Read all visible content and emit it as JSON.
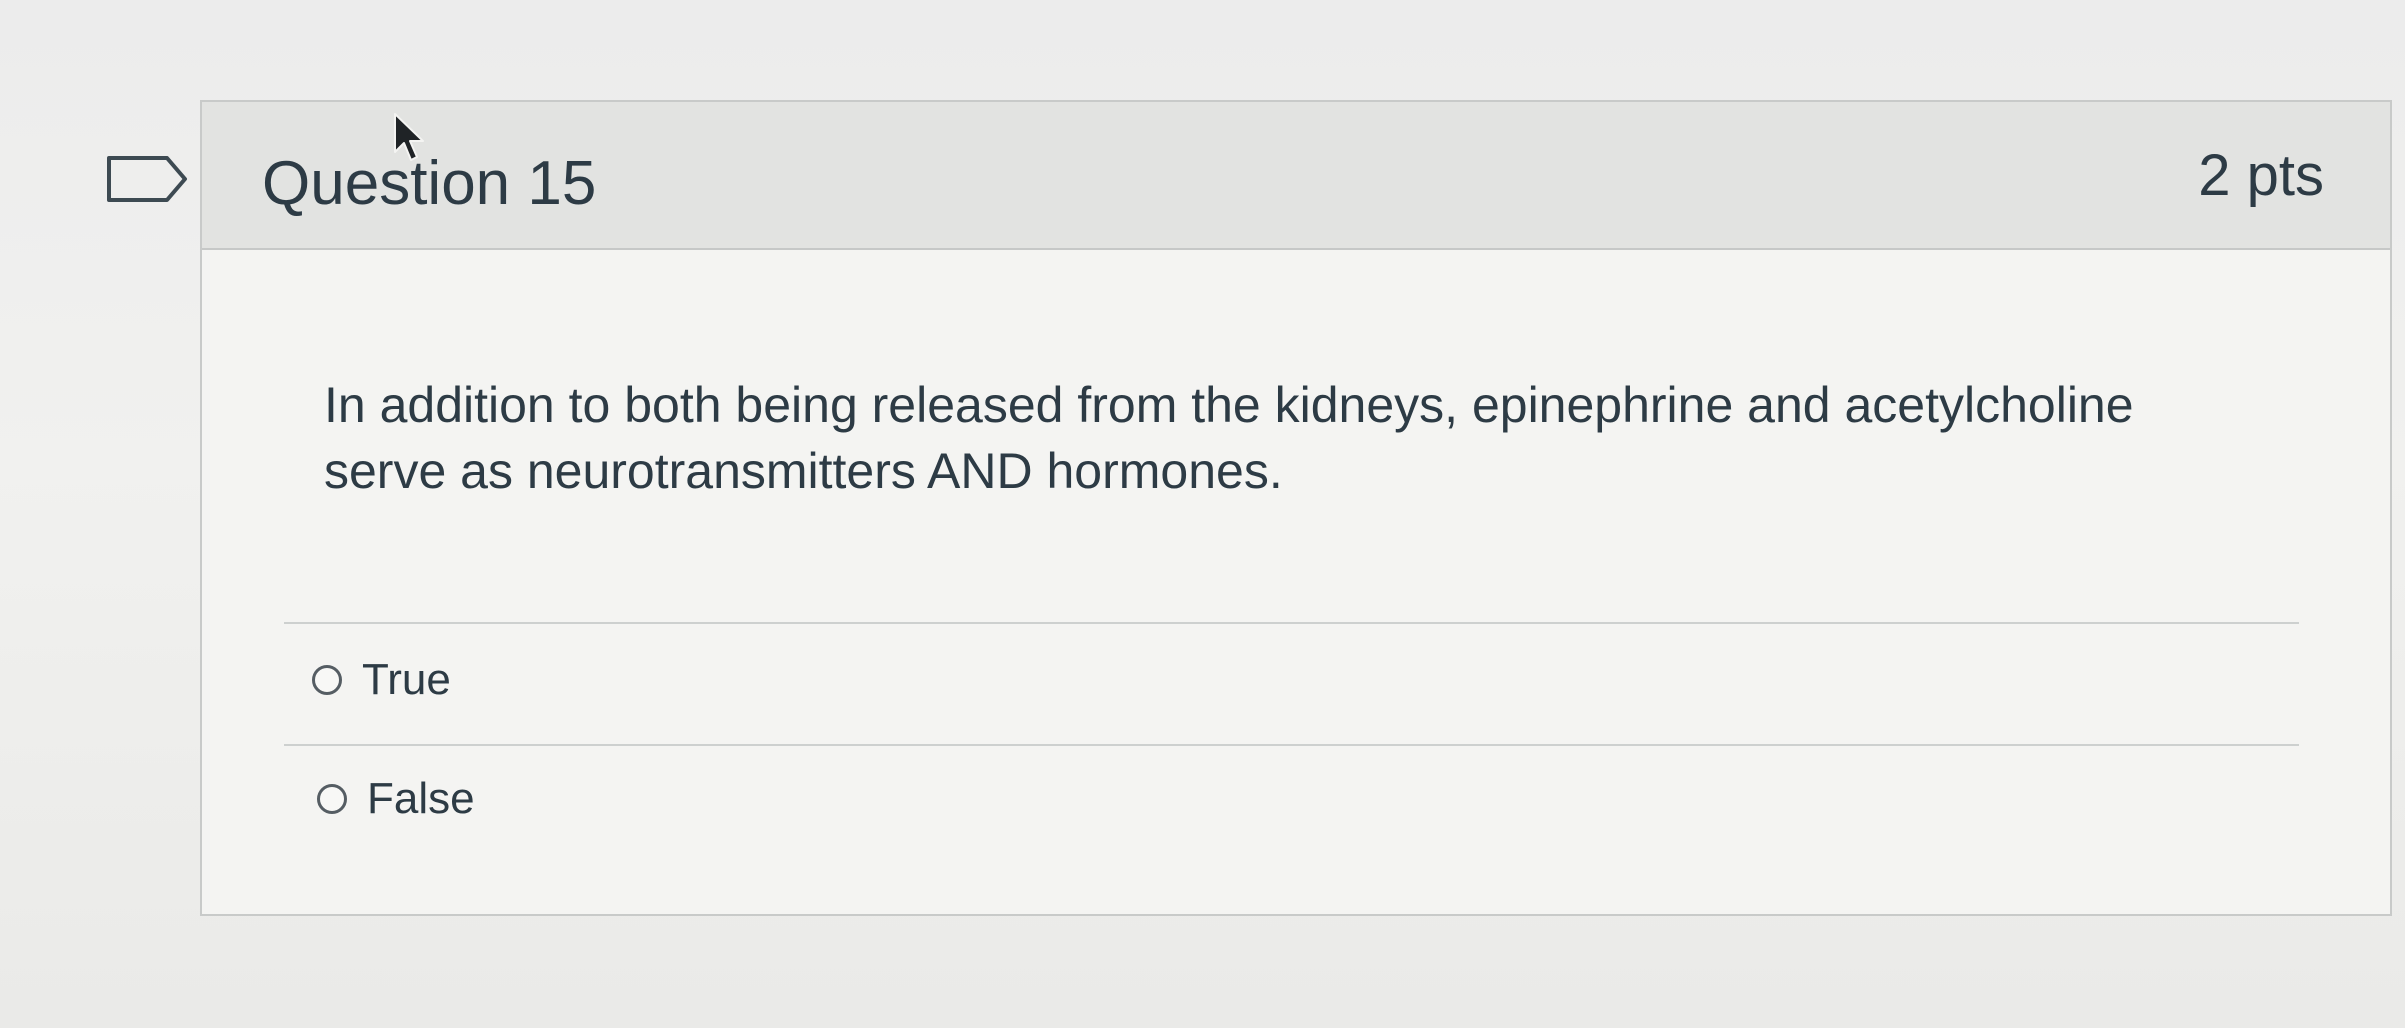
{
  "question": {
    "title": "Question 15",
    "points": "2 pts",
    "text": "In addition to both being released from the kidneys, epinephrine and acetylcholine serve as neurotransmitters AND hormones."
  },
  "answers": [
    {
      "label": "True",
      "selected": false
    },
    {
      "label": "False",
      "selected": false
    }
  ],
  "icons": {
    "flag": "flag-question-icon",
    "cursor": "mouse-cursor-icon"
  },
  "colors": {
    "header_bg": "#e2e3e1",
    "card_bg": "#f4f4f2",
    "text": "#2d3b45"
  }
}
